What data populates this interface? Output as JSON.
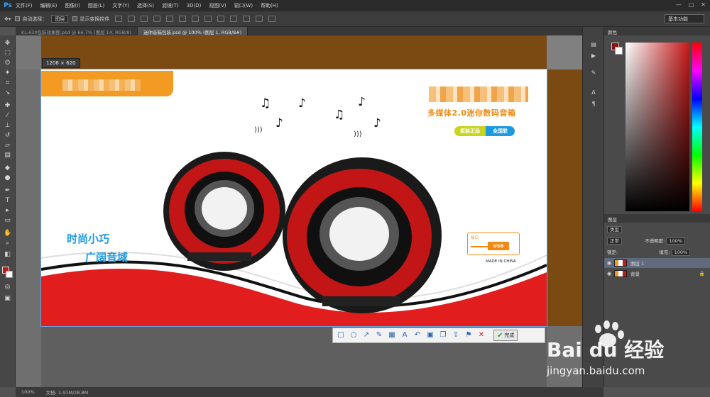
{
  "app": {
    "logo": "Ps"
  },
  "menu": [
    "文件(F)",
    "编辑(E)",
    "图像(I)",
    "图层(L)",
    "文字(Y)",
    "选择(S)",
    "滤镜(T)",
    "3D(D)",
    "视图(V)",
    "窗口(W)",
    "帮助(H)"
  ],
  "options": {
    "auto_select_label": "自动选择：",
    "auto_select_value": "图层",
    "show_transform_label": "显示变换控件",
    "workspace": "基本功能"
  },
  "tabs": [
    {
      "label": "KL-630包装效果图.psd @ 66.7% (图层 14, RGB/8)",
      "active": false
    },
    {
      "label": "迷你音箱包装.psd @ 100% (图层 1, RGB/8#)",
      "active": true
    }
  ],
  "canvas": {
    "dimension_label": "1208 × 620"
  },
  "artwork": {
    "subtitle": "多媒体2.0迷你数码音箱",
    "badge_left": "原装正品",
    "badge_right": "全国联",
    "slogan_line1": "时尚小巧",
    "slogan_line2": "广阔音域",
    "usb_caption": "接口",
    "usb_label": "USB",
    "made_in": "MADE IN CHINA"
  },
  "annotation_toolbar": {
    "done_label": "完成"
  },
  "panels": {
    "color_header": "颜色",
    "layers_header": "图层",
    "layers_kind": "类型",
    "blend_mode": "正常",
    "opacity_label": "不透明度:",
    "opacity_value": "100%",
    "lock_label": "锁定:",
    "fill_label": "填充:",
    "fill_value": "100%",
    "layers": [
      {
        "name": "图层 1",
        "active": true
      },
      {
        "name": "背景",
        "active": false
      }
    ]
  },
  "status": {
    "zoom": "100%",
    "doc_label": "文档:",
    "doc_size": "1.91M/28.8M"
  },
  "watermark": {
    "brand": "Bai  du 经验",
    "url": "jingyan.baidu.com"
  },
  "colors": {
    "accent_orange": "#f39a23",
    "accent_blue": "#1b9ae0",
    "accent_red": "#d91f1f",
    "foreground_color": "#c01a1a"
  }
}
